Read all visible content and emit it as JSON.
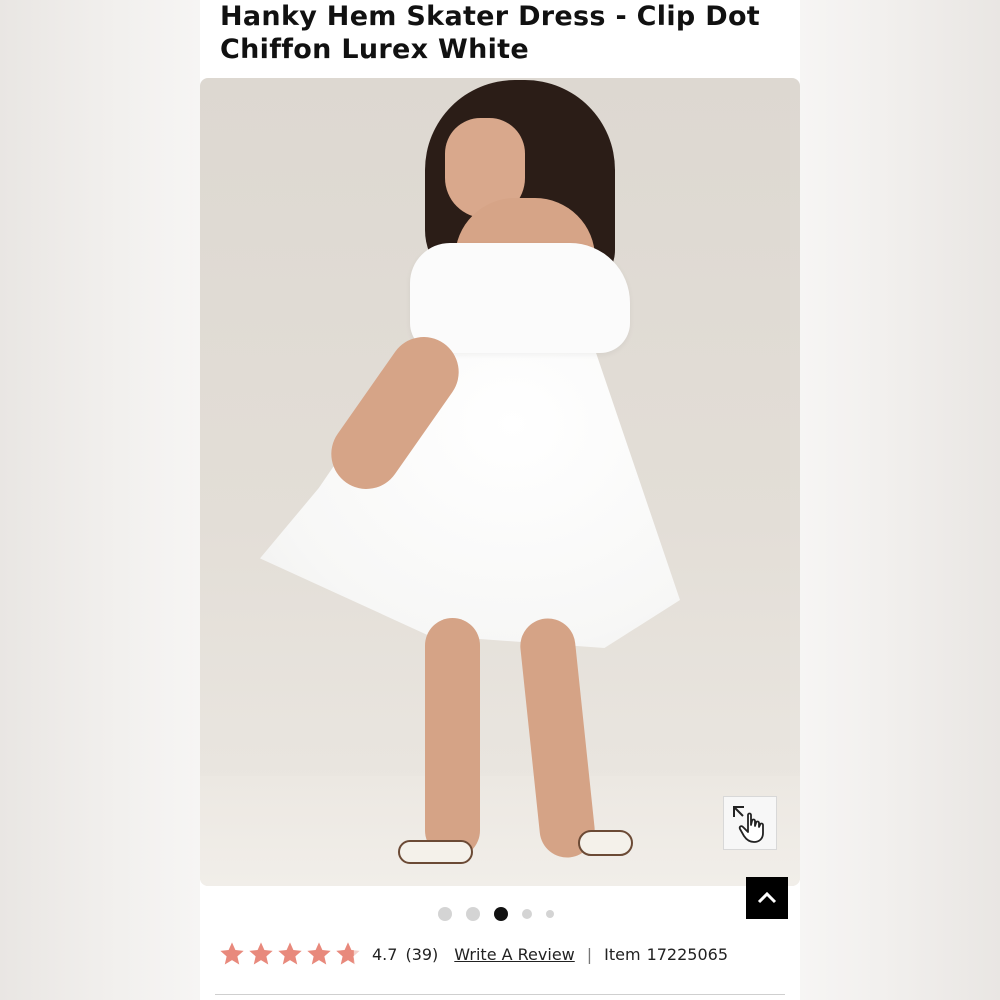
{
  "product": {
    "title": "Hanky Hem Skater Dress - Clip Dot Chiffon Lurex White"
  },
  "gallery": {
    "image_alt": "Model wearing white cold-shoulder ruffled skater dress",
    "slide_count": 5,
    "active_slide": 3,
    "zoom_icon": "tap-to-zoom-icon"
  },
  "scroll_top_icon": "chevron-up-icon",
  "reviews": {
    "rating": "4.7",
    "count": "(39)",
    "stars_filled": 4.7,
    "star_color": "#e8897c",
    "write_review_label": "Write A Review",
    "separator": "|"
  },
  "item": {
    "label": "Item",
    "number": "17225065"
  }
}
